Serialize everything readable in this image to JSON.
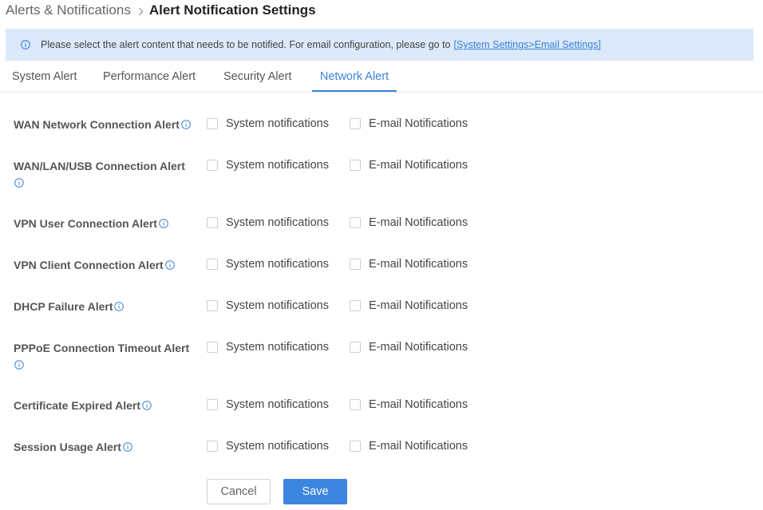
{
  "breadcrumb": {
    "parent": "Alerts & Notifications",
    "current": "Alert Notification Settings"
  },
  "banner": {
    "text": "Please select the alert content that needs to be notified. For email configuration, please go to",
    "link": "[System Settings>Email Settings]"
  },
  "tabs": [
    {
      "label": "System Alert"
    },
    {
      "label": "Performance Alert"
    },
    {
      "label": "Security Alert"
    },
    {
      "label": "Network Alert"
    }
  ],
  "active_tab": "Network Alert",
  "options": {
    "system": "System notifications",
    "email": "E-mail Notifications"
  },
  "alerts": [
    {
      "label": "WAN Network Connection Alert",
      "system": false,
      "email": false
    },
    {
      "label": "WAN/LAN/USB Connection Alert",
      "system": false,
      "email": false
    },
    {
      "label": "VPN User Connection Alert",
      "system": false,
      "email": false
    },
    {
      "label": "VPN Client Connection Alert",
      "system": false,
      "email": false
    },
    {
      "label": "DHCP Failure Alert",
      "system": false,
      "email": false
    },
    {
      "label": "PPPoE Connection Timeout Alert",
      "system": false,
      "email": false
    },
    {
      "label": "Certificate Expired Alert",
      "system": false,
      "email": false
    },
    {
      "label": "Session Usage Alert",
      "system": false,
      "email": false
    }
  ],
  "buttons": {
    "cancel": "Cancel",
    "save": "Save"
  },
  "colors": {
    "accent": "#3b82d9",
    "banner_bg": "#dbe9fb",
    "save_bg": "#3c86e0"
  },
  "icons": {
    "banner": "info-icon",
    "alert_info": "info-icon",
    "breadcrumb_separator": "chevron-right-icon"
  }
}
